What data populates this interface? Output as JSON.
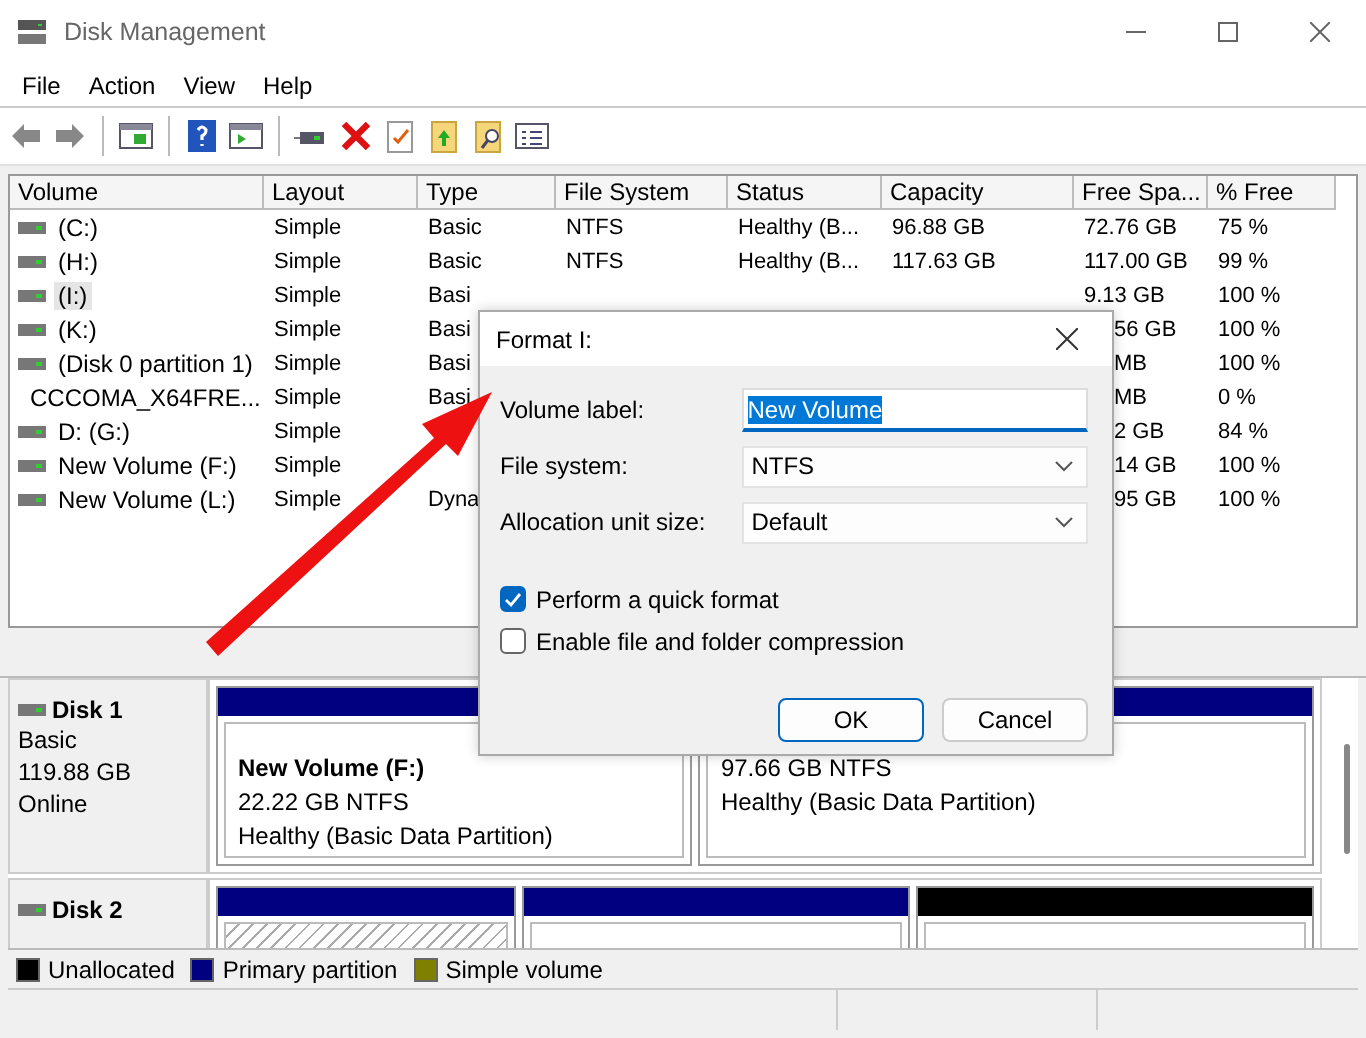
{
  "window": {
    "title": "Disk Management"
  },
  "menu": [
    "File",
    "Action",
    "View",
    "Help"
  ],
  "volume_table": {
    "columns": [
      "Volume",
      "Layout",
      "Type",
      "File System",
      "Status",
      "Capacity",
      "Free Spa...",
      "% Free"
    ],
    "rows": [
      {
        "kind": "disk",
        "selected": false,
        "volume": "(C:)",
        "layout": "Simple",
        "type": "Basic",
        "file_system": "NTFS",
        "status": "Healthy (B...",
        "capacity": "96.88 GB",
        "free_space": "72.76 GB",
        "percent_free": "75 %"
      },
      {
        "kind": "disk",
        "selected": false,
        "volume": "(H:)",
        "layout": "Simple",
        "type": "Basic",
        "file_system": "NTFS",
        "status": "Healthy (B...",
        "capacity": "117.63 GB",
        "free_space": "117.00 GB",
        "percent_free": "99 %"
      },
      {
        "kind": "disk",
        "selected": true,
        "volume": "(I:)",
        "layout": "Simple",
        "type": "Basi",
        "free_space": "9.13 GB",
        "percent_free": "100 %"
      },
      {
        "kind": "disk",
        "selected": false,
        "volume": "(K:)",
        "layout": "Simple",
        "type": "Basi",
        "free_space": "56 GB",
        "percent_free": "100 %"
      },
      {
        "kind": "disk",
        "selected": false,
        "volume": "(Disk 0 partition 1)",
        "layout": "Simple",
        "type": "Basi",
        "free_space": "MB",
        "percent_free": "100 %"
      },
      {
        "kind": "optical",
        "selected": false,
        "volume": "CCCOMA_X64FRE...",
        "layout": "Simple",
        "type": "Basi",
        "free_space": "MB",
        "percent_free": "0 %"
      },
      {
        "kind": "disk",
        "selected": false,
        "volume": "D: (G:)",
        "layout": "Simple",
        "free_space": "2 GB",
        "percent_free": "84 %"
      },
      {
        "kind": "disk",
        "selected": false,
        "volume": "New Volume (F:)",
        "layout": "Simple",
        "free_space": "14 GB",
        "percent_free": "100 %"
      },
      {
        "kind": "disk",
        "selected": false,
        "volume": "New Volume (L:)",
        "layout": "Simple",
        "type": "Dyna",
        "free_space": "95 GB",
        "percent_free": "100 %"
      }
    ]
  },
  "disks": [
    {
      "name": "Disk 1",
      "type": "Basic",
      "size": "119.88 GB",
      "status": "Online",
      "partitions": [
        {
          "kind": "primary",
          "selected": false,
          "name": "New Volume  (F:)",
          "details": "22.22 GB NTFS",
          "status": "Healthy (Basic Data Partition)"
        },
        {
          "kind": "primary",
          "selected": false,
          "details": "97.66 GB NTFS",
          "status": "Healthy (Basic Data Partition)"
        }
      ]
    },
    {
      "name": "Disk 2",
      "partitions": [
        {
          "kind": "primary",
          "selected": true
        },
        {
          "kind": "primary",
          "selected": false
        },
        {
          "kind": "unallocated",
          "selected": false
        }
      ]
    }
  ],
  "legend": [
    {
      "label": "Unallocated",
      "color": "#000000"
    },
    {
      "label": "Primary partition",
      "color": "#000080"
    },
    {
      "label": "Simple volume",
      "color": "#808000"
    }
  ],
  "format_dialog": {
    "title": "Format I:",
    "fields": [
      {
        "kind": "text",
        "label": "Volume label:",
        "value": "New Volume",
        "selected": true
      },
      {
        "kind": "select",
        "label": "File system:",
        "value": "NTFS"
      },
      {
        "kind": "select",
        "label": "Allocation unit size:",
        "value": "Default"
      }
    ],
    "options": [
      {
        "label": "Perform a quick format",
        "checked": true
      },
      {
        "label": "Enable file and folder compression",
        "checked": false
      }
    ],
    "buttons": [
      {
        "label": "OK",
        "default": true
      },
      {
        "label": "Cancel",
        "default": false
      }
    ]
  }
}
